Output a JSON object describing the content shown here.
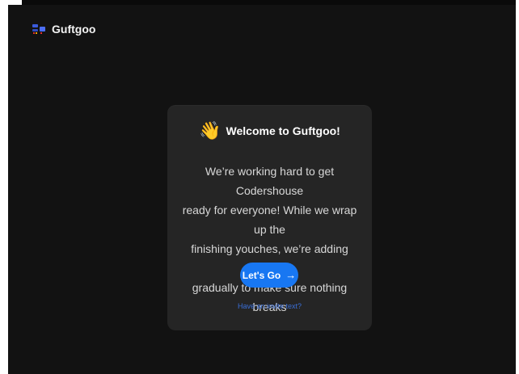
{
  "brand": {
    "name": "Guftgoo",
    "icon": "chat-logo-icon"
  },
  "card": {
    "emoji": "👋",
    "title": "Welcome to Guftgoo!",
    "body_lines": [
      "We’re working hard to get Codershouse",
      "ready for everyone! While we wrap up the",
      "finishing youches, we’re adding people",
      "gradually to make sure nothing breaks"
    ],
    "button_label": "Let's Go",
    "button_icon": "arrow-right-icon",
    "invite_link": "Have an invite text?"
  },
  "colors": {
    "app_background": "#121212",
    "card_background": "#252525",
    "accent": "#1877f2",
    "link": "#3a6fd8"
  }
}
